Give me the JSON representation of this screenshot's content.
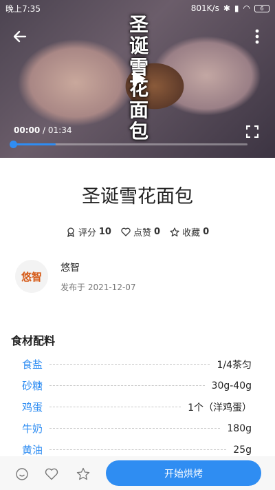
{
  "status_bar": {
    "left": "晚上7:35",
    "speed": "801K/s",
    "battery": "6"
  },
  "video": {
    "title_vertical": "圣诞雪花面包",
    "current_time": "00:00",
    "separator": " / ",
    "duration": "01:34",
    "progress": 0.18
  },
  "recipe": {
    "title": "圣诞雪花面包",
    "stats": {
      "score_label": "评分",
      "score_value": "10",
      "likes_label": "点赞",
      "likes_value": "0",
      "favorites_label": "收藏",
      "favorites_value": "0"
    },
    "author": {
      "avatar_text": "悠智",
      "name": "悠智",
      "date": "发布于 2021-12-07"
    },
    "section_title": "食材配料",
    "ingredients": [
      {
        "name": "食盐",
        "qty": "1/4茶匀"
      },
      {
        "name": "砂糖",
        "qty": "30g-40g"
      },
      {
        "name": "鸡蛋",
        "qty": "1个（洋鸡蛋）"
      },
      {
        "name": "牛奶",
        "qty": "180g"
      },
      {
        "name": "黄油",
        "qty": "25g"
      }
    ]
  },
  "bottom_bar": {
    "start_button": "开始烘烤"
  },
  "colors": {
    "accent": "#2f8df2",
    "text": "#222222"
  }
}
